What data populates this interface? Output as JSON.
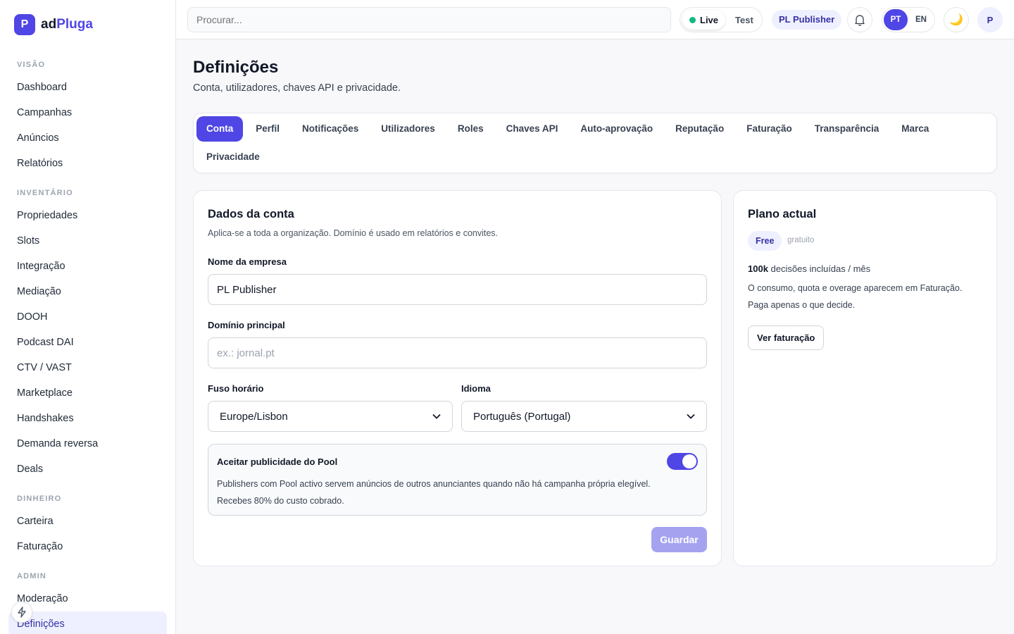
{
  "brand": {
    "mark": "P",
    "name_prefix": "ad",
    "name_accent": "Pluga",
    "accent_color": "#4f46e5"
  },
  "sidebar": {
    "sections": [
      {
        "title": "VISÃO",
        "items": [
          "Dashboard",
          "Campanhas",
          "Anúncios",
          "Relatórios"
        ]
      },
      {
        "title": "INVENTÁRIO",
        "items": [
          "Propriedades",
          "Slots",
          "Integração",
          "Mediação",
          "DOOH",
          "Podcast DAI",
          "CTV / VAST",
          "Marketplace",
          "Handshakes",
          "Demanda reversa",
          "Deals"
        ]
      },
      {
        "title": "DINHEIRO",
        "items": [
          "Carteira",
          "Faturação"
        ]
      },
      {
        "title": "ADMIN",
        "items": [
          "Moderação",
          "Definições"
        ]
      }
    ],
    "active_item": "Definições",
    "floating_icon": "bolt-icon"
  },
  "topbar": {
    "search_placeholder": "Procurar...",
    "mode_live": "Live",
    "mode_test": "Test",
    "publisher": "PL Publisher",
    "lang_pt": "PT",
    "lang_en": "EN",
    "theme_icon": "🌙",
    "avatar": "P"
  },
  "page": {
    "title": "Definições",
    "subtitle": "Conta, utilizadores, chaves API e privacidade."
  },
  "tabs": [
    "Conta",
    "Perfil",
    "Notificações",
    "Utilizadores",
    "Roles",
    "Chaves API",
    "Auto-aprovação",
    "Reputação",
    "Faturação",
    "Transparência",
    "Marca",
    "Privacidade"
  ],
  "account": {
    "title": "Dados da conta",
    "description": "Aplica-se a toda a organização. Domínio é usado em relatórios e convites.",
    "company_label": "Nome da empresa",
    "company_value": "PL Publisher",
    "domain_label": "Domínio principal",
    "domain_placeholder": "ex.: jornal.pt",
    "timezone_label": "Fuso horário",
    "timezone_value": "Europe/Lisbon",
    "language_label": "Idioma",
    "language_value": "Português (Portugal)",
    "pool_title": "Aceitar publicidade do Pool",
    "pool_text": "Publishers com Pool activo servem anúncios de outros anunciantes quando não há campanha própria elegível. Recebes 80% do custo cobrado.",
    "pool_enabled": true,
    "save_label": "Guardar"
  },
  "plan": {
    "title": "Plano actual",
    "badge": "Free",
    "badge_note": "gratuito",
    "quota_strong": "100k",
    "quota_rest": " decisões incluídas / mês",
    "note": "O consumo, quota e overage aparecem em Faturação. Paga apenas o que decide.",
    "button": "Ver faturação"
  }
}
